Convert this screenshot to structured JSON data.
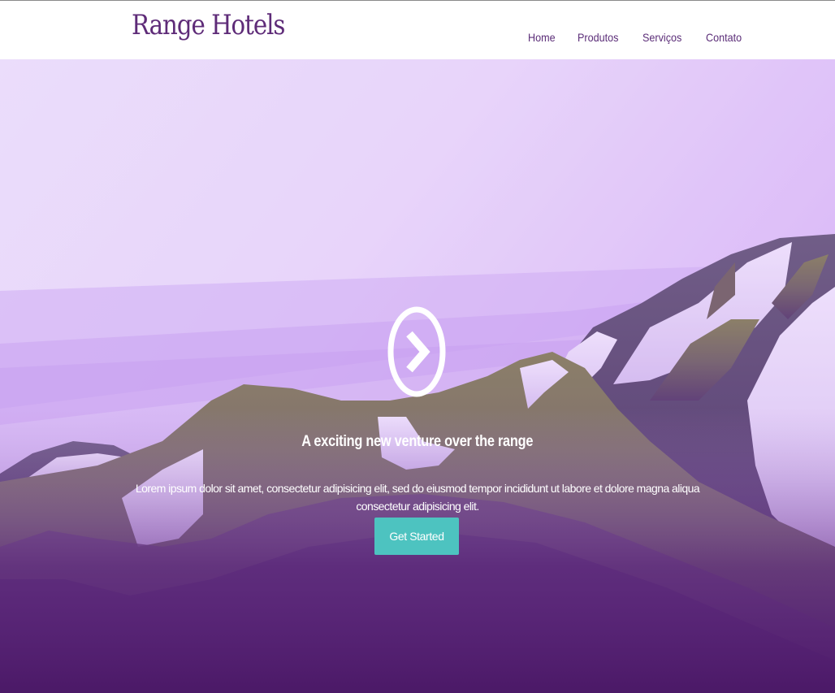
{
  "header": {
    "brand": "Range Hotels",
    "nav": [
      {
        "label": "Home"
      },
      {
        "label": "Produtos"
      },
      {
        "label": "Serviços"
      },
      {
        "label": "Contato"
      }
    ]
  },
  "hero": {
    "play_icon": "chevron-right-circle-icon",
    "title": "A exciting new venture over the range",
    "text": "Lorem ipsum dolor sit amet, consectetur adipisicing elit, sed do eiusmod tempor incididunt ut labore et dolore magna aliqua consectetur adipisicing elit.",
    "cta_label": "Get Started"
  },
  "colors": {
    "brand": "#5e2b78",
    "accent": "#4dc3c0",
    "overlay_top": "#e9d8fb",
    "overlay_bottom": "#4a1766"
  }
}
